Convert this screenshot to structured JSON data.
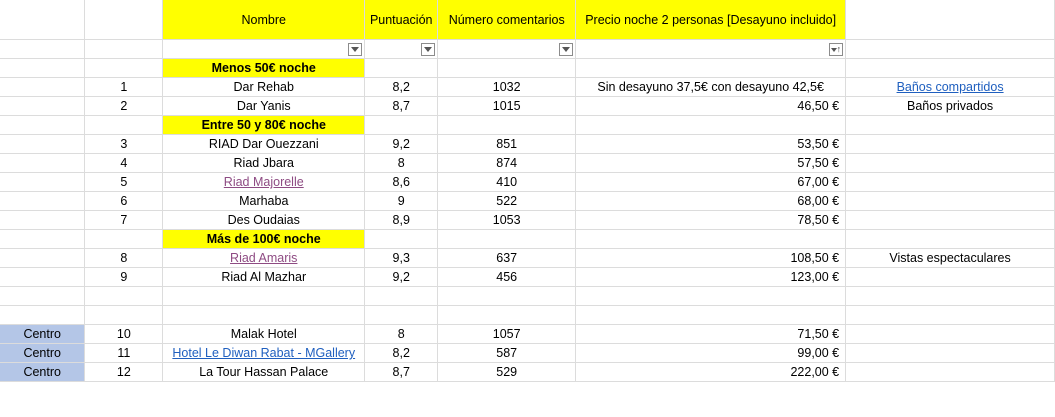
{
  "header": {
    "nombre": "Nombre",
    "puntuacion": "Puntuación",
    "comentarios": "Número comentarios",
    "precio": "Precio noche 2 personas [Desayuno incluido]"
  },
  "groups": {
    "g1": "Menos 50€ noche",
    "g2": "Entre 50 y 80€ noche",
    "g3": "Más de 100€ noche"
  },
  "rows": [
    {
      "num": "1",
      "name": "Dar Rehab",
      "score": "8,2",
      "comments": "1032",
      "price": "Sin desayuno 37,5€ con desayuno 42,5€",
      "note": "Baños compartidos"
    },
    {
      "num": "2",
      "name": "Dar Yanis",
      "score": "8,7",
      "comments": "1015",
      "price": "46,50 €",
      "note": "Baños privados"
    },
    {
      "num": "3",
      "name": "RIAD Dar Ouezzani",
      "score": "9,2",
      "comments": "851",
      "price": "53,50 €",
      "note": ""
    },
    {
      "num": "4",
      "name": "Riad Jbara",
      "score": "8",
      "comments": "874",
      "price": "57,50 €",
      "note": ""
    },
    {
      "num": "5",
      "name": "Riad Majorelle",
      "score": "8,6",
      "comments": "410",
      "price": "67,00 €",
      "note": ""
    },
    {
      "num": "6",
      "name": "Marhaba",
      "score": "9",
      "comments": "522",
      "price": "68,00 €",
      "note": ""
    },
    {
      "num": "7",
      "name": "Des Oudaias",
      "score": "8,9",
      "comments": "1053",
      "price": "78,50 €",
      "note": ""
    },
    {
      "num": "8",
      "name": "Riad Amaris",
      "score": "9,3",
      "comments": "637",
      "price": "108,50 €",
      "note": "Vistas espectaculares"
    },
    {
      "num": "9",
      "name": "Riad Al Mazhar",
      "score": "9,2",
      "comments": "456",
      "price": "123,00 €",
      "note": ""
    },
    {
      "num": "10",
      "name": "Malak Hotel",
      "score": "8",
      "comments": "1057",
      "price": "71,50 €",
      "note": "",
      "zone": "Centro"
    },
    {
      "num": "11",
      "name": "Hotel Le Diwan Rabat - MGallery",
      "score": "8,2",
      "comments": "587",
      "price": "99,00 €",
      "note": "",
      "zone": "Centro"
    },
    {
      "num": "12",
      "name": "La Tour Hassan Palace",
      "score": "8,7",
      "comments": "529",
      "price": "222,00 €",
      "note": "",
      "zone": "Centro"
    }
  ],
  "icons": {
    "filter": "filter-dropdown-icon",
    "sort": "sort-ascending-filter-icon"
  }
}
